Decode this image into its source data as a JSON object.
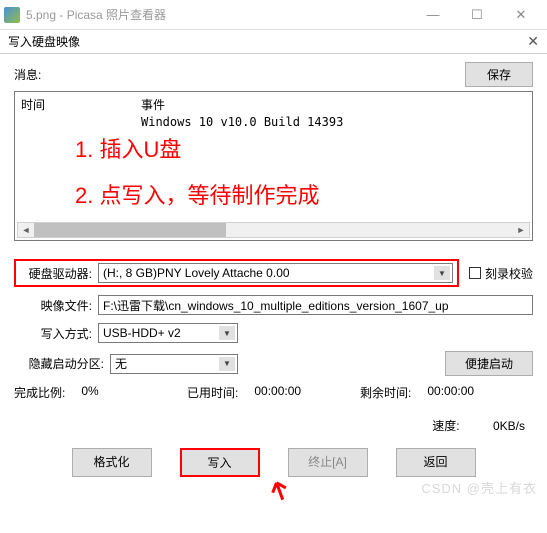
{
  "outerWindow": {
    "title": "5.png - Picasa 照片查看器"
  },
  "dialog": {
    "title": "写入硬盘映像"
  },
  "message": {
    "label": "消息:",
    "saveBtn": "保存"
  },
  "log": {
    "timeHeader": "时间",
    "eventHeader": "事件",
    "line1": "Windows 10 v10.0 Build 14393"
  },
  "annotations": {
    "a1": "1. 插入U盘",
    "a2": "2. 点写入，等待制作完成"
  },
  "fields": {
    "drive": {
      "label": "硬盘驱动器:",
      "value": "(H:, 8 GB)PNY    Lovely Attache  0.00"
    },
    "verify": {
      "label": "刻录校验"
    },
    "image": {
      "label": "映像文件:",
      "value": "F:\\迅雷下载\\cn_windows_10_multiple_editions_version_1607_up"
    },
    "mode": {
      "label": "写入方式:",
      "value": "USB-HDD+ v2"
    },
    "hidden": {
      "label": "隐藏启动分区:",
      "value": "无"
    },
    "convBoot": {
      "label": "便捷启动"
    }
  },
  "stats": {
    "progressLabel": "完成比例:",
    "progressValue": "0%",
    "elapsedLabel": "已用时间:",
    "elapsedValue": "00:00:00",
    "remainLabel": "剩余时间:",
    "remainValue": "00:00:00",
    "speedLabel": "速度:",
    "speedValue": "0KB/s"
  },
  "buttons": {
    "format": "格式化",
    "write": "写入",
    "abort": "终止[A]",
    "back": "返回"
  },
  "watermark": "CSDN @壳上有衣"
}
